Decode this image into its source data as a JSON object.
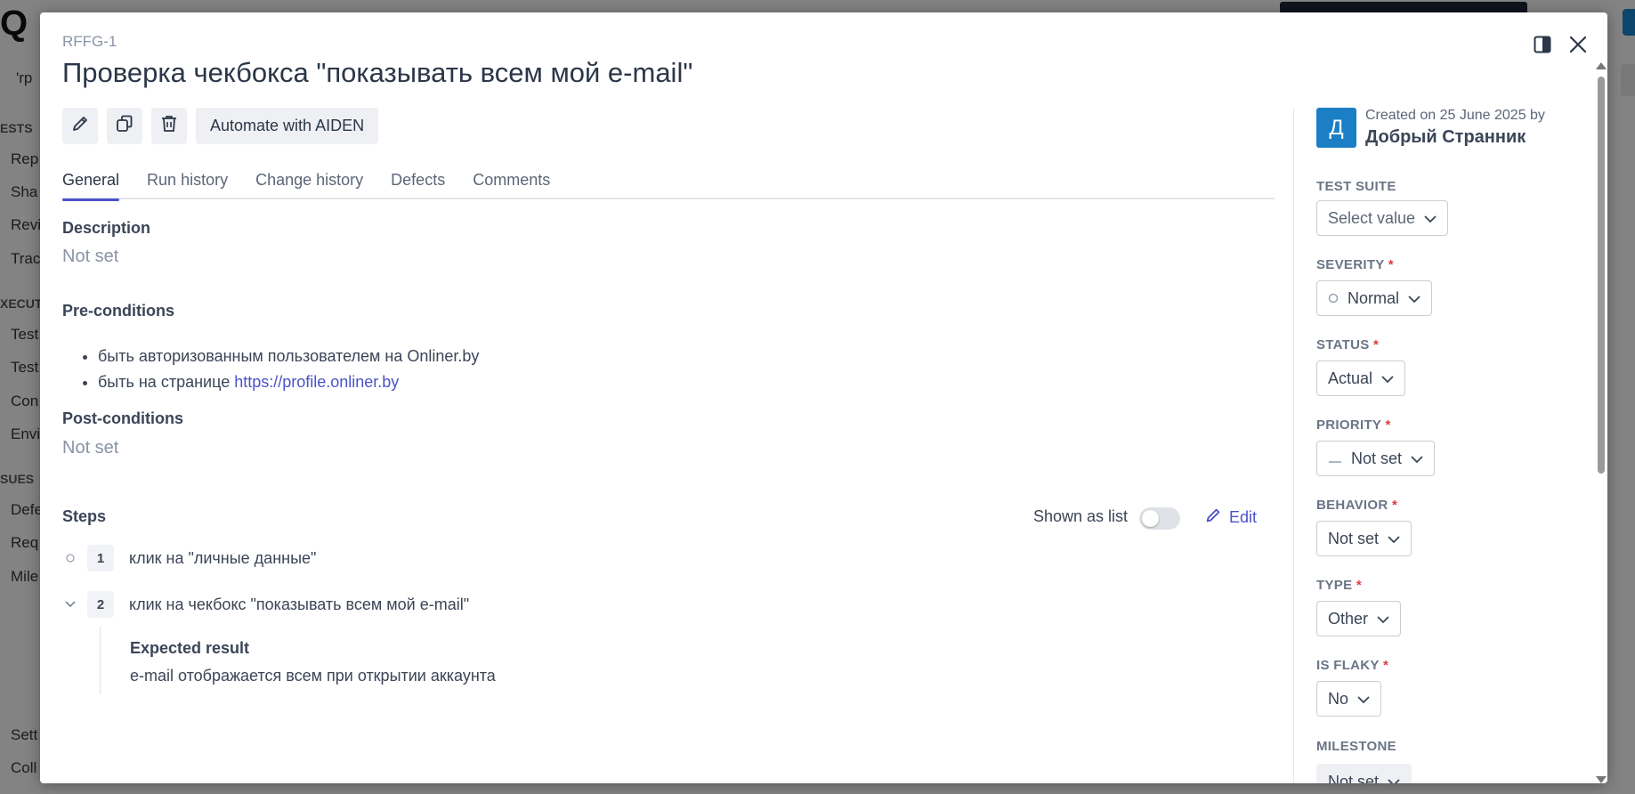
{
  "background": {
    "logo": "Q",
    "top_label": "'rp",
    "sidebar_sections": [
      "ESTS",
      "XECUT",
      "SUES"
    ],
    "sidebar_items": [
      "Rep",
      "Sha",
      "Revi",
      "Trac",
      "Test",
      "Test",
      "Con",
      "Envi",
      "Defe",
      "Req",
      "Mile",
      "Sett",
      "Coll"
    ]
  },
  "modal": {
    "case_id": "RFFG-1",
    "title": "Проверка чекбокса \"показывать всем мой e-mail\"",
    "toolbar": {
      "edit_icon": "pencil-icon",
      "copy_icon": "copy-icon",
      "delete_icon": "trash-icon",
      "automate_label": "Automate with AIDEN"
    },
    "tabs": [
      {
        "label": "General",
        "active": true
      },
      {
        "label": "Run history"
      },
      {
        "label": "Change history"
      },
      {
        "label": "Defects"
      },
      {
        "label": "Comments"
      }
    ],
    "description": {
      "label": "Description",
      "value": "Not set"
    },
    "preconditions": {
      "label": "Pre-conditions",
      "items": [
        {
          "text": "быть авторизованным пользователем на Onliner.by",
          "link": ""
        },
        {
          "text": "быть на странице ",
          "link": "https://profile.onliner.by"
        }
      ]
    },
    "postconditions": {
      "label": "Post-conditions",
      "value": "Not set"
    },
    "steps": {
      "label": "Steps",
      "shown_as_list_label": "Shown as list",
      "edit_label": "Edit",
      "items": [
        {
          "num": "1",
          "text": "клик на \"личные данные\""
        },
        {
          "num": "2",
          "text": "клик на чекбокс \"показывать всем мой e-mail\"",
          "expected_label": "Expected result",
          "expected": "e-mail отображается всем при открытии аккаунта"
        }
      ]
    },
    "sidebar": {
      "avatar_letter": "Д",
      "created_text": "Created on 25 June 2025 by",
      "creator": "Добрый Странник",
      "fields": [
        {
          "label": "TEST SUITE",
          "required": false,
          "value": "Select value"
        },
        {
          "label": "SEVERITY",
          "required": true,
          "value": "Normal"
        },
        {
          "label": "STATUS",
          "required": true,
          "value": "Actual"
        },
        {
          "label": "PRIORITY",
          "required": true,
          "value": "Not set"
        },
        {
          "label": "BEHAVIOR",
          "required": true,
          "value": "Not set"
        },
        {
          "label": "TYPE",
          "required": true,
          "value": "Other"
        },
        {
          "label": "IS FLAKY",
          "required": true,
          "value": "No"
        },
        {
          "label": "MILESTONE",
          "required": false,
          "value": "Not set"
        }
      ]
    },
    "colors": {
      "accent": "#4b52c9",
      "avatar": "#1b7fc6",
      "required": "#e0393e"
    }
  }
}
